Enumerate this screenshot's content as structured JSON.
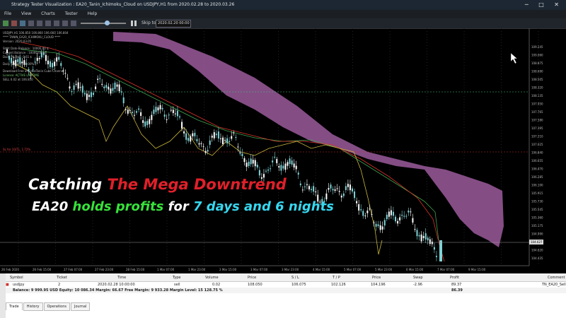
{
  "window": {
    "title": "Strategy Tester Visualization : EA20_Tanin_Ichimoku_Cloud on USDJPY,H1 from 2020.02.28 to 2020.03.26",
    "controls": "─ □ ✕"
  },
  "menu": [
    "File",
    "View",
    "Charts",
    "Tester",
    "Help"
  ],
  "toolbar": {
    "skip_label": "Skip to",
    "skip_date": "2020.02.20 00:00"
  },
  "chart_info": {
    "symbol_line": "USDJPY,H1 106.850 106.860 106.660 106.804",
    "indicator": "**** TANIN_EA20_ICHIMOKU_CLOUD ****",
    "version": "Version: 2020.03.05",
    "lines": [
      "Start Date Balance : 10000.00 $",
      "Current Balance : 10000.00 $",
      "Daily P/L ($) : 0.61 $",
      "Daily Status [ +0.00% ]",
      "Download Free at LinusTanin Cube Channel",
      "License: ACTIVE LIFETIME",
      "SELL 0.02 at 106.850"
    ],
    "sl_label": "SL for 10/TL, 1.72%"
  },
  "price_ticks": [
    "109.245",
    "109.060",
    "108.875",
    "108.690",
    "108.505",
    "108.320",
    "108.135",
    "107.950",
    "107.765",
    "107.580",
    "107.395",
    "107.210",
    "107.025",
    "106.840",
    "106.655",
    "106.470",
    "106.285",
    "106.100",
    "105.915",
    "105.730",
    "105.545",
    "105.360",
    "105.175",
    "104.990",
    "104.805",
    "104.620",
    "104.435"
  ],
  "current_price": "104.627",
  "time_ticks": [
    "26 Feb 2020",
    "26 Feb 15:00",
    "27 Feb 07:00",
    "27 Feb 23:00",
    "28 Feb 15:00",
    "1 Mar 07:00",
    "1 Mar 23:00",
    "2 Mar 15:00",
    "3 Mar 07:00",
    "3 Mar 23:00",
    "4 Mar 15:00",
    "5 Mar 07:00",
    "5 Mar 23:00",
    "6 Mar 15:00",
    "7 Mar 07:00",
    "9 Mar 15:00"
  ],
  "overlay": {
    "line1_a": "Catching ",
    "line1_b": "The Mega Downtrend",
    "line2_a": "EA20 ",
    "line2_b": "holds profits",
    "line2_c": " for ",
    "line2_d": "7 days and 6 nights"
  },
  "terminal": {
    "headers": [
      "Symbol",
      "Ticket",
      "Time",
      "Type",
      "Volume",
      "Price",
      "S / L",
      "T / P",
      "Price",
      "Swap",
      "Profit",
      "Comment"
    ],
    "row": [
      "usdjpy",
      "2",
      "2020.02.28 10:00:00",
      "sell",
      "0.02",
      "108.050",
      "106.075",
      "102.126",
      "104.196",
      "-2.96",
      "89.37",
      "TN_EA20_Sell"
    ],
    "balance": "Balance: 9 999.95 USD  Equity: 10 086.34  Margin: 66.67  Free Margin: 9 933.28  Margin Level: 15 128.75 %",
    "balance_profit": "86.39",
    "tabs": [
      "Trade",
      "History",
      "Operations",
      "Journal"
    ],
    "side_label": "Toolbox"
  },
  "colors": {
    "cloud": "#9b5a9b",
    "candle_up": "#7fd3d6",
    "candle_down": "#ffffff",
    "tenkan": "#d9342b",
    "kijun": "#3fa34d",
    "chikou": "#c9b63a"
  }
}
